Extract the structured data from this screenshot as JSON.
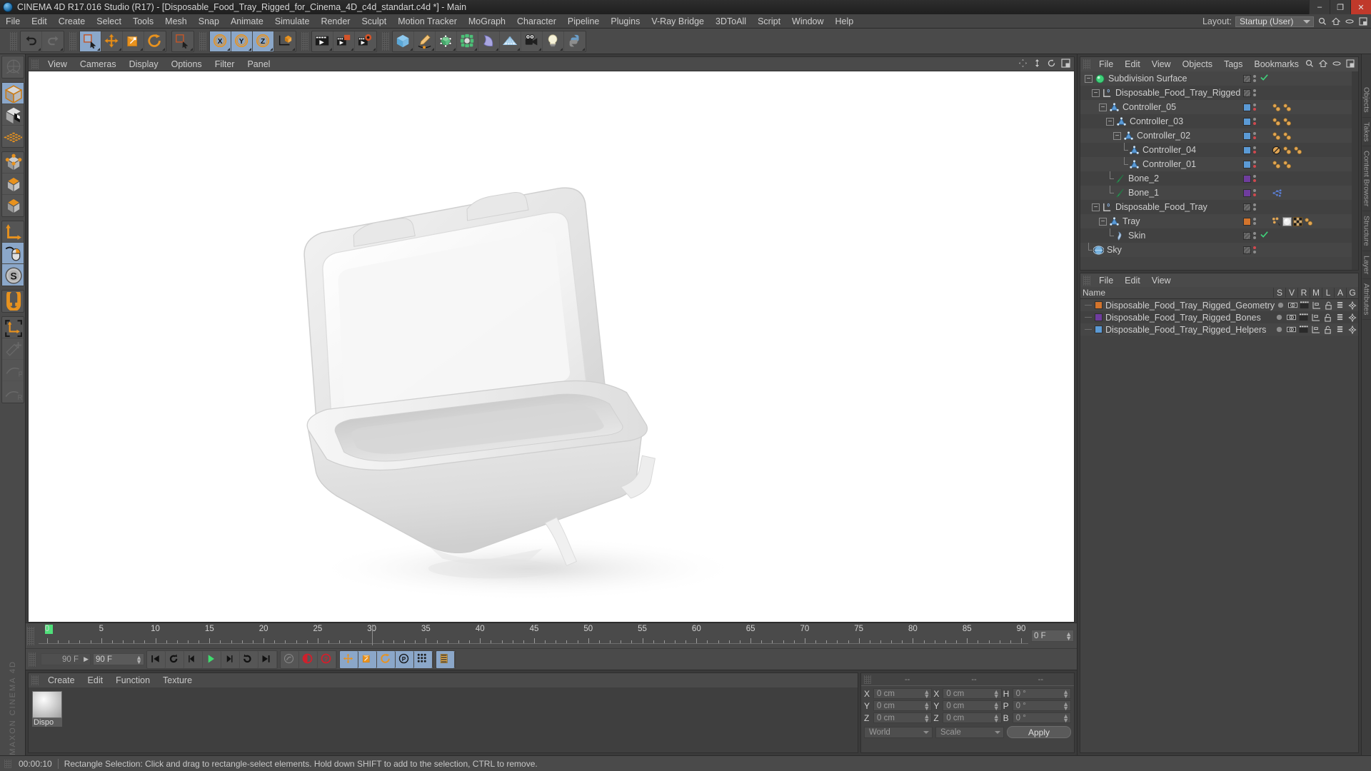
{
  "window": {
    "title": "CINEMA 4D R17.016 Studio (R17) - [Disposable_Food_Tray_Rigged_for_Cinema_4D_c4d_standart.c4d *] - Main",
    "minimize": "–",
    "maximize": "❐",
    "close": "✕"
  },
  "menu": {
    "items": [
      "File",
      "Edit",
      "Create",
      "Select",
      "Tools",
      "Mesh",
      "Snap",
      "Animate",
      "Simulate",
      "Render",
      "Sculpt",
      "Motion Tracker",
      "MoGraph",
      "Character",
      "Pipeline",
      "Plugins",
      "V-Ray Bridge",
      "3DToAll",
      "Script",
      "Window",
      "Help"
    ],
    "layout_label": "Layout:",
    "layout_value": "Startup (User)"
  },
  "toolbar": {
    "groups": [
      {
        "name": "undo-redo",
        "buttons": [
          {
            "name": "undo-button",
            "icon": "undo-icon"
          },
          {
            "name": "redo-button",
            "icon": "redo-icon"
          }
        ]
      },
      {
        "name": "transform-tools",
        "buttons": [
          {
            "name": "live-selection-button",
            "icon": "live-selection-icon",
            "active": true
          },
          {
            "name": "move-button",
            "icon": "move-icon"
          },
          {
            "name": "scale-button",
            "icon": "scale-icon"
          },
          {
            "name": "rotate-button",
            "icon": "rotate-icon"
          }
        ]
      },
      {
        "name": "select-mode",
        "buttons": [
          {
            "name": "selection-mode-button",
            "icon": "cursor-select-icon"
          }
        ]
      },
      {
        "name": "axis-locks",
        "buttons": [
          {
            "name": "lock-x-button",
            "icon": "axis-x-icon",
            "active": true
          },
          {
            "name": "lock-y-button",
            "icon": "axis-y-icon",
            "active": true
          },
          {
            "name": "lock-z-button",
            "icon": "axis-z-icon",
            "active": true
          },
          {
            "name": "world-object-coord-button",
            "icon": "world-axis-icon"
          }
        ]
      },
      {
        "name": "render-tools",
        "buttons": [
          {
            "name": "render-view-button",
            "icon": "render-view-icon"
          },
          {
            "name": "render-region-button",
            "icon": "render-region-icon"
          },
          {
            "name": "render-settings-button",
            "icon": "render-settings-icon"
          }
        ]
      },
      {
        "name": "create-objects",
        "buttons": [
          {
            "name": "add-cube-button",
            "icon": "cube-icon"
          },
          {
            "name": "add-spline-button",
            "icon": "pen-spline-icon"
          },
          {
            "name": "add-nurbs-button",
            "icon": "nurbs-icon"
          },
          {
            "name": "add-modeling-object-button",
            "icon": "array-icon"
          },
          {
            "name": "add-deformer-button",
            "icon": "bend-deformer-icon"
          },
          {
            "name": "add-environment-button",
            "icon": "floor-environment-icon"
          },
          {
            "name": "add-camera-button",
            "icon": "camera-icon"
          },
          {
            "name": "add-light-button",
            "icon": "light-bulb-icon"
          },
          {
            "name": "python-button",
            "icon": "python-icon"
          }
        ]
      }
    ]
  },
  "lefttools": {
    "buttons": [
      {
        "name": "make-editable-button",
        "icon": "make-editable-icon",
        "dim": true
      },
      {
        "name": "model-mode-button",
        "icon": "model-mode-icon",
        "active": true
      },
      {
        "name": "texture-mode-button",
        "icon": "texture-mode-icon"
      },
      {
        "name": "points-grid-button",
        "icon": "points-grid-icon"
      },
      {
        "name": "point-mode-button",
        "icon": "point-mode-icon"
      },
      {
        "name": "edge-mode-button",
        "icon": "edge-mode-icon"
      },
      {
        "name": "polygon-mode-button",
        "icon": "polygon-mode-icon"
      },
      {
        "name": "axis-modify-button",
        "icon": "axis-modify-icon"
      },
      {
        "name": "viewport-solo-button",
        "icon": "mouse-icon",
        "active": true
      },
      {
        "name": "enable-snap-button",
        "icon": "s-circle-icon",
        "active": true
      },
      {
        "name": "magnet-button",
        "icon": "magnet-icon"
      },
      {
        "name": "workplane-button",
        "icon": "workplane-icon"
      },
      {
        "name": "move-plus-button",
        "icon": "move-plus-icon",
        "dim": true
      },
      {
        "name": "rotate-p-button",
        "icon": "rotate-p-icon",
        "dim": true
      },
      {
        "name": "scale-r-button",
        "icon": "scale-r-icon",
        "dim": true
      }
    ],
    "brand": "MAXON CINEMA 4D"
  },
  "viewport": {
    "menu": [
      "View",
      "Cameras",
      "Display",
      "Options",
      "Filter",
      "Panel"
    ],
    "icons": [
      "pan-icon",
      "zoom-icon",
      "rotate-view-icon",
      "maximize-view-icon"
    ],
    "scene_description": "White polystyrene disposable food tray, hinged lid open, 3D perspective view"
  },
  "timeline": {
    "ticks": [
      0,
      5,
      10,
      15,
      20,
      25,
      30,
      35,
      40,
      45,
      50,
      55,
      60,
      65,
      70,
      75,
      80,
      85,
      90
    ],
    "current_frame": "0 F",
    "current_frame_field": "0 F",
    "end_frame_preview": "90 F",
    "end_frame": "90 F",
    "playhead_frame": 0,
    "green_marker_frame": 0
  },
  "powerbar": {
    "transport": [
      {
        "name": "go-to-start-button",
        "icon": "skip-start-icon"
      },
      {
        "name": "previous-keyframe-button",
        "icon": "prev-key-icon"
      },
      {
        "name": "step-back-button",
        "icon": "step-back-icon"
      },
      {
        "name": "play-button",
        "icon": "play-icon"
      },
      {
        "name": "step-forward-button",
        "icon": "step-forward-icon"
      },
      {
        "name": "next-keyframe-button",
        "icon": "next-key-icon"
      },
      {
        "name": "go-to-end-button",
        "icon": "skip-end-icon"
      }
    ],
    "record": [
      {
        "name": "autokey-toggle-button",
        "icon": "autokey-icon"
      },
      {
        "name": "record-active-objects-button",
        "icon": "record-icon"
      },
      {
        "name": "keyframe-selection-button",
        "icon": "key-selection-icon"
      }
    ],
    "keyflags": [
      {
        "name": "key-position-button",
        "icon": "position-key-icon"
      },
      {
        "name": "key-scale-button",
        "icon": "scale-key-icon"
      },
      {
        "name": "key-rotation-button",
        "icon": "rotation-key-icon"
      },
      {
        "name": "key-param-button",
        "icon": "param-key-icon"
      },
      {
        "name": "key-pla-button",
        "icon": "pla-key-icon"
      }
    ],
    "extra": [
      {
        "name": "timeline-button",
        "icon": "timeline-icon"
      }
    ]
  },
  "material_manager": {
    "menu": [
      "Create",
      "Edit",
      "Function",
      "Texture"
    ],
    "materials": [
      {
        "name": "Dispo",
        "label": "Dispo"
      }
    ]
  },
  "coordinates": {
    "header": [
      "--",
      "--",
      "--"
    ],
    "rows": [
      {
        "pos_label": "X",
        "pos_value": "0 cm",
        "size_label": "X",
        "size_value": "0 cm",
        "rot_label": "H",
        "rot_value": "0 °"
      },
      {
        "pos_label": "Y",
        "pos_value": "0 cm",
        "size_label": "Y",
        "size_value": "0 cm",
        "rot_label": "P",
        "rot_value": "0 °"
      },
      {
        "pos_label": "Z",
        "pos_value": "0 cm",
        "size_label": "Z",
        "size_value": "0 cm",
        "rot_label": "B",
        "rot_value": "0 °"
      }
    ],
    "system": "World",
    "mode": "Scale",
    "apply": "Apply"
  },
  "object_manager": {
    "menu": [
      "File",
      "Edit",
      "View",
      "Objects",
      "Tags",
      "Bookmarks"
    ],
    "header_icons": [
      "search-icon",
      "home-icon",
      "ellipse-icon",
      "new-window-icon"
    ],
    "rows": [
      {
        "name": "Subdivision Surface",
        "depth": 0,
        "icon": "subdivision-surface-icon",
        "expander": "minus",
        "swatch": "diag",
        "dots": [
          "grey"
        ],
        "check": true,
        "tags": []
      },
      {
        "name": "Disposable_Food_Tray_Rigged",
        "depth": 1,
        "icon": "null-object-icon",
        "expander": "minus",
        "swatch": "diag",
        "dots": [
          "grey"
        ],
        "check": false,
        "tags": []
      },
      {
        "name": "Controller_05",
        "depth": 2,
        "icon": "joint-icon",
        "expander": "minus",
        "swatch": "#5b9ad5",
        "dots": [
          "grey",
          "red"
        ],
        "check": false,
        "tags": [
          "constraint",
          "constraint"
        ]
      },
      {
        "name": "Controller_03",
        "depth": 3,
        "icon": "joint-icon",
        "expander": "minus",
        "swatch": "#5b9ad5",
        "dots": [
          "grey",
          "red"
        ],
        "check": false,
        "tags": [
          "constraint",
          "constraint"
        ]
      },
      {
        "name": "Controller_02",
        "depth": 4,
        "icon": "joint-icon",
        "expander": "minus",
        "swatch": "#5b9ad5",
        "dots": [
          "grey",
          "red"
        ],
        "check": false,
        "tags": [
          "constraint",
          "constraint"
        ]
      },
      {
        "name": "Controller_04",
        "depth": 5,
        "icon": "joint-icon",
        "expander": "leaf",
        "swatch": "#5b9ad5",
        "dots": [
          "grey",
          "red"
        ],
        "check": false,
        "tags": [
          "protection",
          "constraint",
          "constraint"
        ]
      },
      {
        "name": "Controller_01",
        "depth": 5,
        "icon": "joint-icon",
        "expander": "leaf",
        "swatch": "#5b9ad5",
        "dots": [
          "grey",
          "red"
        ],
        "check": false,
        "tags": [
          "constraint",
          "constraint"
        ]
      },
      {
        "name": "Bone_2",
        "depth": 3,
        "icon": "bone-icon",
        "expander": "leaf",
        "swatch": "#6f3d9e",
        "dots": [
          "grey",
          "red"
        ],
        "check": false,
        "tags": []
      },
      {
        "name": "Bone_1",
        "depth": 3,
        "icon": "bone-icon",
        "expander": "leaf",
        "swatch": "#6f3d9e",
        "dots": [
          "grey",
          "red"
        ],
        "check": false,
        "tags": [
          "weight"
        ]
      },
      {
        "name": "Disposable_Food_Tray",
        "depth": 1,
        "icon": "null-object-icon",
        "expander": "minus",
        "swatch": "diag",
        "dots": [
          "grey"
        ],
        "check": false,
        "tags": []
      },
      {
        "name": "Tray",
        "depth": 2,
        "icon": "joint-icon",
        "expander": "minus",
        "swatch": "#d3742c",
        "dots": [
          "grey"
        ],
        "check": false,
        "tags": [
          "vertexmap",
          "material",
          "uv",
          "constraint"
        ]
      },
      {
        "name": "Skin",
        "depth": 3,
        "icon": "skin-deformer-icon",
        "expander": "leaf",
        "swatch": "diag",
        "dots": [
          "grey"
        ],
        "check": true,
        "tags": []
      },
      {
        "name": "Sky",
        "depth": 0,
        "icon": "sky-icon",
        "expander": "leaf",
        "swatch": "diag",
        "dots": [
          "red"
        ],
        "check": false,
        "tags": []
      }
    ]
  },
  "layer_manager": {
    "menu": [
      "File",
      "Edit",
      "View"
    ],
    "columns": [
      "Name",
      "S",
      "V",
      "R",
      "M",
      "L",
      "A",
      "G"
    ],
    "rows": [
      {
        "name": "Disposable_Food_Tray_Rigged_Geometry",
        "color": "#d3742c"
      },
      {
        "name": "Disposable_Food_Tray_Rigged_Bones",
        "color": "#6f3d9e"
      },
      {
        "name": "Disposable_Food_Tray_Rigged_Helpers",
        "color": "#5b9ad5"
      }
    ]
  },
  "right_tabs": [
    "Objects",
    "Takes",
    "Content Browser",
    "Structure",
    "Layer",
    "Attributes"
  ],
  "status_bar": {
    "time": "00:00:10",
    "message": "Rectangle Selection: Click and drag to rectangle-select elements. Hold down SHIFT to add to the selection, CTRL to remove."
  },
  "colors": {
    "accent_orange": "#e8921e",
    "accent_blue": "#8ba7c9",
    "panel_bg": "#434343",
    "toolbar_bg": "#4a4a4a",
    "viewport_bg": "#ffffff"
  }
}
